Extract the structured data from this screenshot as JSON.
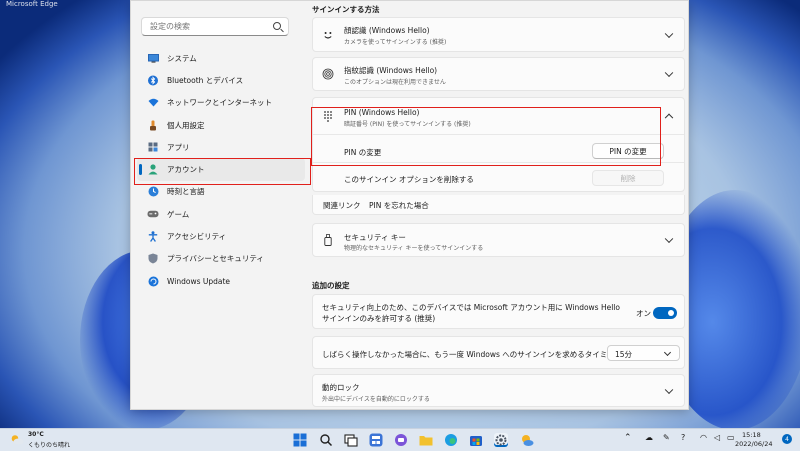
{
  "browser_edge_label": "Microsoft Edge",
  "sidebar": {
    "search_placeholder": "設定の検索",
    "items": [
      {
        "label": "システム",
        "icon": "monitor-icon",
        "active": false
      },
      {
        "label": "Bluetooth とデバイス",
        "icon": "bluetooth-icon",
        "active": false
      },
      {
        "label": "ネットワークとインターネット",
        "icon": "wifi-icon",
        "active": false
      },
      {
        "label": "個人用設定",
        "icon": "brush-icon",
        "active": false
      },
      {
        "label": "アプリ",
        "icon": "apps-icon",
        "active": false
      },
      {
        "label": "アカウント",
        "icon": "person-icon",
        "active": true
      },
      {
        "label": "時刻と言語",
        "icon": "globe-clock-icon",
        "active": false
      },
      {
        "label": "ゲーム",
        "icon": "gamepad-icon",
        "active": false
      },
      {
        "label": "アクセシビリティ",
        "icon": "accessibility-icon",
        "active": false
      },
      {
        "label": "プライバシーとセキュリティ",
        "icon": "shield-icon",
        "active": false
      },
      {
        "label": "Windows Update",
        "icon": "update-icon",
        "active": false
      }
    ]
  },
  "content": {
    "signin_header": "サインインする方法",
    "face": {
      "title": "顔認識 (Windows Hello)",
      "subtitle": "カメラを使ってサインインする (推奨)"
    },
    "fingerprint": {
      "title": "指紋認識 (Windows Hello)",
      "subtitle": "このオプションは現在利用できません"
    },
    "pin": {
      "title": "PIN (Windows Hello)",
      "subtitle": "暗証番号 (PIN) を使ってサインインする (推奨)",
      "change_label": "PIN の変更",
      "change_button": "PIN の変更",
      "remove_label": "このサインイン オプションを削除する",
      "remove_button": "削除",
      "related_label": "関連リンク",
      "forgot_link": "PIN を忘れた場合"
    },
    "security_key": {
      "title": "セキュリティ キー",
      "subtitle": "物理的なセキュリティ キーを使ってサインインする"
    },
    "additional_header": "追加の設定",
    "hello_only": {
      "line1": "セキュリティ向上のため、このデバイスでは Microsoft アカウント用に Windows Hello",
      "line2": "サインインのみを許可する (推奨)",
      "toggle_label": "オン",
      "toggle_on": true
    },
    "reauth": {
      "label": "しばらく操作しなかった場合に、もう一度 Windows へのサインインを求めるタイミング",
      "value": "15分"
    },
    "dynamic_lock": {
      "title": "動的ロック",
      "subtitle": "外出中にデバイスを自動的にロックする"
    }
  },
  "taskbar": {
    "weather_temp": "30°C",
    "weather_desc": "くもりのち晴れ",
    "time": "15:18",
    "date": "2022/06/24",
    "notification_count": "4",
    "accent_color": "#0067c0"
  }
}
